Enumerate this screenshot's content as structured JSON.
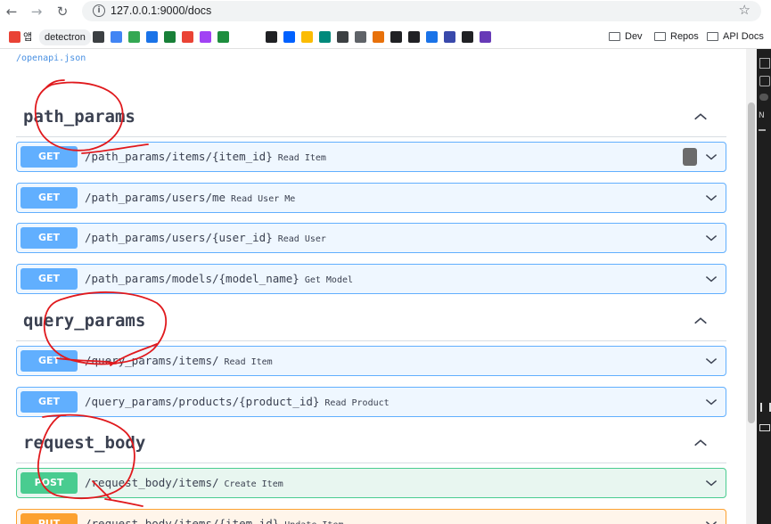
{
  "browser": {
    "url": "127.0.0.1:9000/docs",
    "nav": {
      "back": "←",
      "forward": "→",
      "reload": "↻",
      "star": "☆"
    }
  },
  "bookmarks": {
    "items": [
      {
        "label": "앱",
        "color": "#e94235"
      },
      {
        "label": "detectron",
        "chip": true
      },
      {
        "label": "",
        "color": "#3c4043"
      },
      {
        "label": "",
        "color": "#4285f4"
      },
      {
        "label": "",
        "color": "#34a853"
      },
      {
        "label": "",
        "color": "#1a73e8"
      },
      {
        "label": "",
        "color": "#188038"
      },
      {
        "label": "",
        "color": "#ea4335"
      },
      {
        "label": "",
        "color": "#a142f4"
      },
      {
        "label": "",
        "color": "#1e8e3e"
      },
      {
        "label": "",
        "color": "#202124"
      },
      {
        "label": "",
        "color": "#0061ff"
      },
      {
        "label": "",
        "color": "#fbbc04"
      },
      {
        "label": "",
        "color": "#00897b"
      },
      {
        "label": "",
        "color": "#3c4043"
      },
      {
        "label": "",
        "color": "#5f6368"
      },
      {
        "label": "",
        "color": "#e8710a"
      },
      {
        "label": "",
        "color": "#202124"
      },
      {
        "label": "",
        "color": "#202124"
      },
      {
        "label": "",
        "color": "#1a73e8"
      },
      {
        "label": "",
        "color": "#3949ab"
      },
      {
        "label": "",
        "color": "#202124"
      },
      {
        "label": "",
        "color": "#673ab7"
      }
    ],
    "folders": [
      "Dev",
      "Repos",
      "API Docs"
    ]
  },
  "docs": {
    "openapi_link": "/openapi.json",
    "sections": [
      {
        "title": "path_params",
        "operations": [
          {
            "method": "GET",
            "path": "/path_params/items/{item_id}",
            "summary": "Read Item"
          },
          {
            "method": "GET",
            "path": "/path_params/users/me",
            "summary": "Read User Me"
          },
          {
            "method": "GET",
            "path": "/path_params/users/{user_id}",
            "summary": "Read User"
          },
          {
            "method": "GET",
            "path": "/path_params/models/{model_name}",
            "summary": "Get Model"
          }
        ]
      },
      {
        "title": "query_params",
        "operations": [
          {
            "method": "GET",
            "path": "/query_params/items/",
            "summary": "Read Item"
          },
          {
            "method": "GET",
            "path": "/query_params/products/{product_id}",
            "summary": "Read Product"
          }
        ]
      },
      {
        "title": "request_body",
        "operations": [
          {
            "method": "POST",
            "path": "/request_body/items/",
            "summary": "Create Item"
          },
          {
            "method": "PUT",
            "path": "/request_body/items/{item_id}",
            "summary": "Update Item"
          }
        ]
      }
    ]
  },
  "colors": {
    "get": "#61affe",
    "post": "#49cc90",
    "put": "#fca130",
    "annotation": "#e0191d"
  },
  "sidepanel": {
    "labels": [
      "N"
    ]
  }
}
